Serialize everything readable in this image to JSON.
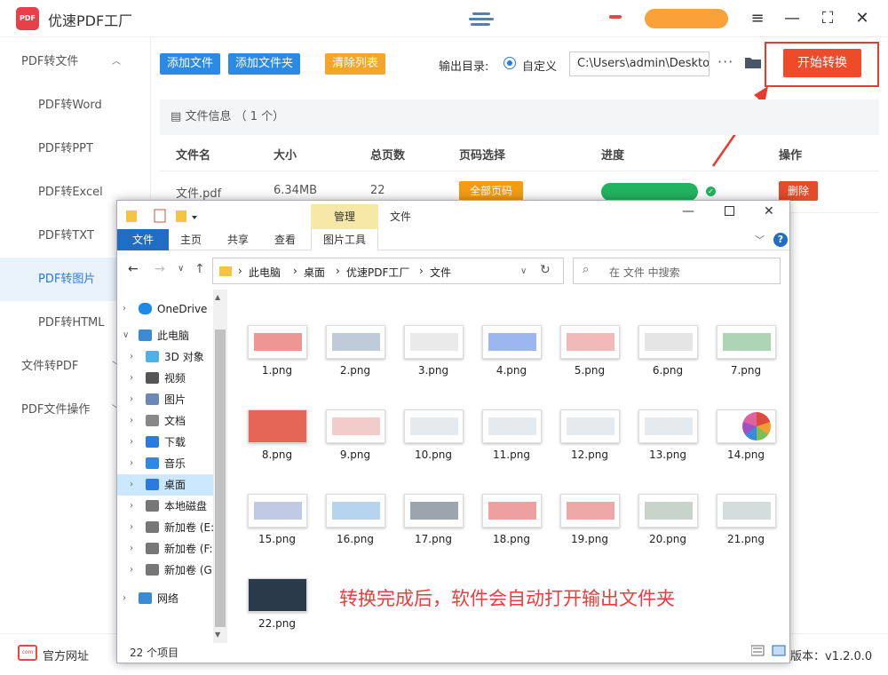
{
  "app": {
    "logo_text": "PDF",
    "title": "优速PDF工厂",
    "version_label": "版本：v1.2.0.0",
    "site_link": "官方网址",
    "site_icon_text": "com"
  },
  "window_controls": [
    "≡",
    "—",
    "⛶",
    "✕"
  ],
  "sidebar": {
    "items": [
      {
        "label": "PDF转文件",
        "kind": "group",
        "chev": "^"
      },
      {
        "label": "PDF转Word",
        "kind": "sub"
      },
      {
        "label": "PDF转PPT",
        "kind": "sub"
      },
      {
        "label": "PDF转Excel",
        "kind": "sub"
      },
      {
        "label": "PDF转TXT",
        "kind": "sub"
      },
      {
        "label": "PDF转图片",
        "kind": "sub",
        "active": true
      },
      {
        "label": "PDF转HTML",
        "kind": "sub"
      },
      {
        "label": "文件转PDF",
        "kind": "group",
        "chev": "v"
      },
      {
        "label": "PDF文件操作",
        "kind": "group",
        "chev": "v"
      }
    ]
  },
  "toolbar": {
    "add_file": "添加文件",
    "add_folder": "添加文件夹",
    "clear_list": "清除列表",
    "output_label": "输出目录:",
    "radio_label": "自定义",
    "output_path": "C:\\Users\\admin\\Desktop",
    "dots": "···",
    "start": "开始转换"
  },
  "file_table": {
    "info": "文件信息 （ 1 个）",
    "headers": [
      "文件名",
      "大小",
      "总页数",
      "页码选择",
      "进度",
      "操作"
    ],
    "row": {
      "name": "文件.pdf",
      "size": "6.34MB",
      "pages": "22",
      "page_select": "全部页码",
      "progress": 1.0,
      "action": "删除"
    }
  },
  "explorer": {
    "manage_tab": "管理",
    "window_title": "文件",
    "tabs": [
      "文件",
      "主页",
      "共享",
      "查看",
      "图片工具"
    ],
    "breadcrumb": [
      "此电脑",
      "桌面",
      "优速PDF工厂",
      "文件"
    ],
    "search_placeholder": "在 文件 中搜索",
    "nav": [
      {
        "label": "OneDrive",
        "icon": "cloud-icon",
        "arrow": ">"
      },
      {
        "label": "此电脑",
        "icon": "computer-icon",
        "arrow": "v"
      },
      {
        "label": "3D 对象",
        "icon": "cube-icon",
        "arrow": ">"
      },
      {
        "label": "视频",
        "icon": "video-icon",
        "arrow": ">"
      },
      {
        "label": "图片",
        "icon": "picture-icon",
        "arrow": ">"
      },
      {
        "label": "文档",
        "icon": "document-icon",
        "arrow": ">"
      },
      {
        "label": "下载",
        "icon": "download-icon",
        "arrow": ">"
      },
      {
        "label": "音乐",
        "icon": "music-icon",
        "arrow": ">"
      },
      {
        "label": "桌面",
        "icon": "desktop-icon",
        "arrow": ">",
        "selected": true
      },
      {
        "label": "本地磁盘",
        "icon": "drive-icon",
        "arrow": ">"
      },
      {
        "label": "新加卷 (E:",
        "icon": "drive-icon",
        "arrow": ">"
      },
      {
        "label": "新加卷 (F:",
        "icon": "drive-icon",
        "arrow": ">"
      },
      {
        "label": "新加卷 (G",
        "icon": "drive-icon",
        "arrow": ">"
      },
      {
        "label": "网络",
        "icon": "network-icon",
        "arrow": ">"
      }
    ],
    "files": [
      "1.png",
      "2.png",
      "3.png",
      "4.png",
      "5.png",
      "6.png",
      "7.png",
      "8.png",
      "9.png",
      "10.png",
      "11.png",
      "12.png",
      "13.png",
      "14.png",
      "15.png",
      "16.png",
      "17.png",
      "18.png",
      "19.png",
      "20.png",
      "21.png",
      "22.png"
    ],
    "status": "22 个项目"
  },
  "annotation": "转换完成后，软件会自动打开输出文件夹",
  "colors": {
    "accent_blue": "#2a7ae2",
    "start_red": "#ee4b2b",
    "progress_green": "#22b35e",
    "annotation_red": "#ee3b3b"
  }
}
